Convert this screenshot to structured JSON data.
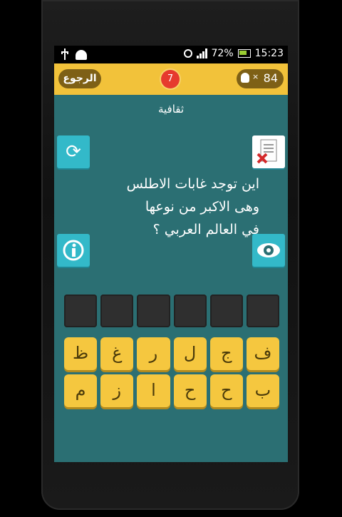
{
  "statusbar": {
    "battery": "72%",
    "time": "15:23"
  },
  "topbar": {
    "back_label": "الرجوع",
    "level": "7",
    "hints_multiplier": "×",
    "hints_count": "84"
  },
  "category": "ثقافية",
  "question": {
    "line1": "اين توجد غابات الاطلس",
    "line2": "وهى الاكبر من نوعها",
    "line3": "في العالم العربي ؟"
  },
  "side_buttons": {
    "refresh": "refresh-icon",
    "delete": "delete-letters-icon",
    "info": "info-icon",
    "reveal": "eye-icon"
  },
  "answer_slots": [
    "",
    "",
    "",
    "",
    "",
    ""
  ],
  "keyboard": {
    "row1": [
      "ظ",
      "غ",
      "ر",
      "ل",
      "ج",
      "ف"
    ],
    "row2": [
      "م",
      "ز",
      "ا",
      "ح",
      "ح",
      "ب"
    ]
  },
  "colors": {
    "background": "#2b6f73",
    "accent": "#f2c23a",
    "button": "#33b9c9",
    "badge": "#e63a2e"
  }
}
